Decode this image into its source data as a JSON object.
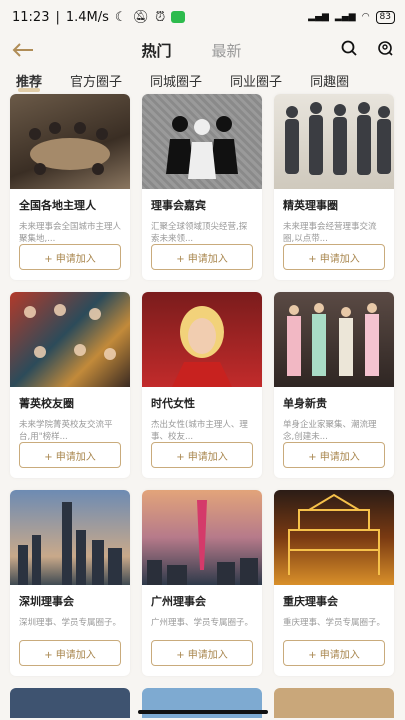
{
  "status": {
    "time": "11:23",
    "speed": "1.4M/s",
    "battery": "83"
  },
  "nav": {
    "tabs": [
      "热门",
      "最新"
    ]
  },
  "categories": [
    "推荐",
    "官方圈子",
    "同城圈子",
    "同业圈子",
    "同趣圈"
  ],
  "join_label": "+ 申请加入",
  "cards": [
    {
      "title": "全国各地主理人",
      "desc": "未来理事会全国城市主理人聚集地,..."
    },
    {
      "title": "理事会嘉宾",
      "desc": "汇聚全球领域顶尖经营,探索未来领..."
    },
    {
      "title": "精英理事圈",
      "desc": "未来理事会经营理事交流圈,以点带..."
    },
    {
      "title": "菁英校友圈",
      "desc": "未来学院菁英校友交流平台,用\"榜样..."
    },
    {
      "title": "时代女性",
      "desc": "杰出女性(城市主理人、理事、校友..."
    },
    {
      "title": "单身新贵",
      "desc": "单身企业家聚集、潮流理念,创建未..."
    },
    {
      "title": "深圳理事会",
      "desc": "深圳理事、学员专属圈子。"
    },
    {
      "title": "广州理事会",
      "desc": "广州理事、学员专属圈子。"
    },
    {
      "title": "重庆理事会",
      "desc": "重庆理事、学员专属圈子。"
    }
  ]
}
